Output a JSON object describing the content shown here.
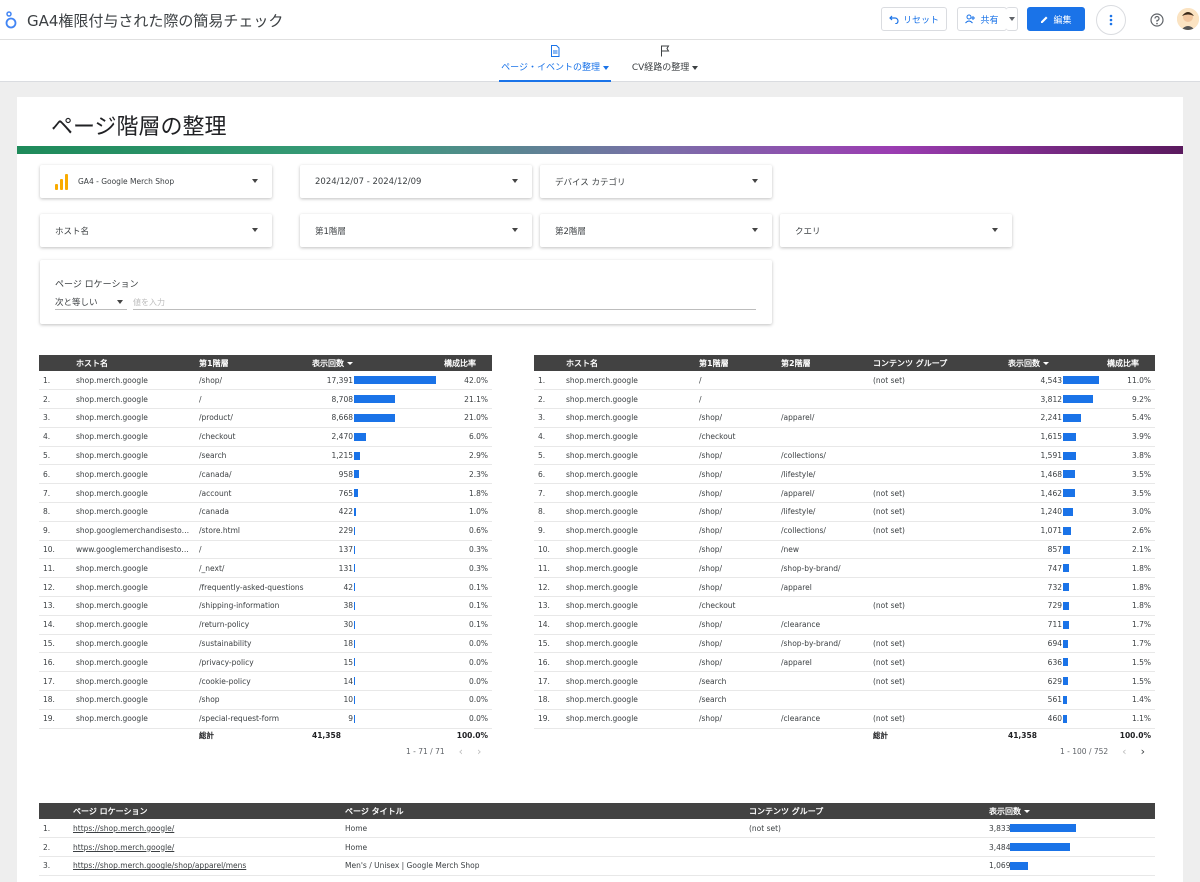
{
  "topbar": {
    "title": "GA4権限付与された際の簡易チェック",
    "reset_label": "リセット",
    "share_label": "共有",
    "edit_label": "編集"
  },
  "pagenav": {
    "pages": [
      {
        "label": "ページ・イベントの整理",
        "active": true
      },
      {
        "label": "CV経路の整理",
        "active": false
      }
    ]
  },
  "page": {
    "heading": "ページ階層の整理"
  },
  "controls": {
    "data_source": "GA4 - Google Merch Shop",
    "date_range": "2024/12/07 - 2024/12/09",
    "device_category": "デバイス カテゴリ",
    "host_name": "ホスト名",
    "level1": "第1階層",
    "level2": "第2階層",
    "query": "クエリ",
    "page_location": {
      "label": "ページ ロケーション",
      "operator": "次と等しい",
      "placeholder": "値を入力"
    }
  },
  "table1": {
    "headers": [
      "ホスト名",
      "第1階層",
      "表示回数",
      "構成比率"
    ],
    "max_value": 17391,
    "rows": [
      {
        "n": "1.",
        "host": "shop.merch.google",
        "l1": "/shop/",
        "views": "17,391",
        "value": 17391,
        "share": "42.0%"
      },
      {
        "n": "2.",
        "host": "shop.merch.google",
        "l1": "/",
        "views": "8,708",
        "value": 8708,
        "share": "21.1%"
      },
      {
        "n": "3.",
        "host": "shop.merch.google",
        "l1": "/product/",
        "views": "8,668",
        "value": 8668,
        "share": "21.0%"
      },
      {
        "n": "4.",
        "host": "shop.merch.google",
        "l1": "/checkout",
        "views": "2,470",
        "value": 2470,
        "share": "6.0%"
      },
      {
        "n": "5.",
        "host": "shop.merch.google",
        "l1": "/search",
        "views": "1,215",
        "value": 1215,
        "share": "2.9%"
      },
      {
        "n": "6.",
        "host": "shop.merch.google",
        "l1": "/canada/",
        "views": "958",
        "value": 958,
        "share": "2.3%"
      },
      {
        "n": "7.",
        "host": "shop.merch.google",
        "l1": "/account",
        "views": "765",
        "value": 765,
        "share": "1.8%"
      },
      {
        "n": "8.",
        "host": "shop.merch.google",
        "l1": "/canada",
        "views": "422",
        "value": 422,
        "share": "1.0%"
      },
      {
        "n": "9.",
        "host": "shop.googlemerchandisestore...",
        "l1": "/store.html",
        "views": "229",
        "value": 229,
        "share": "0.6%"
      },
      {
        "n": "10.",
        "host": "www.googlemerchandisestore...",
        "l1": "/",
        "views": "137",
        "value": 137,
        "share": "0.3%"
      },
      {
        "n": "11.",
        "host": "shop.merch.google",
        "l1": "/_next/",
        "views": "131",
        "value": 131,
        "share": "0.3%"
      },
      {
        "n": "12.",
        "host": "shop.merch.google",
        "l1": "/frequently-asked-questions",
        "views": "42",
        "value": 42,
        "share": "0.1%"
      },
      {
        "n": "13.",
        "host": "shop.merch.google",
        "l1": "/shipping-information",
        "views": "38",
        "value": 38,
        "share": "0.1%"
      },
      {
        "n": "14.",
        "host": "shop.merch.google",
        "l1": "/return-policy",
        "views": "30",
        "value": 30,
        "share": "0.1%"
      },
      {
        "n": "15.",
        "host": "shop.merch.google",
        "l1": "/sustainability",
        "views": "18",
        "value": 18,
        "share": "0.0%"
      },
      {
        "n": "16.",
        "host": "shop.merch.google",
        "l1": "/privacy-policy",
        "views": "15",
        "value": 15,
        "share": "0.0%"
      },
      {
        "n": "17.",
        "host": "shop.merch.google",
        "l1": "/cookie-policy",
        "views": "14",
        "value": 14,
        "share": "0.0%"
      },
      {
        "n": "18.",
        "host": "shop.merch.google",
        "l1": "/shop",
        "views": "10",
        "value": 10,
        "share": "0.0%"
      },
      {
        "n": "19.",
        "host": "shop.merch.google",
        "l1": "/special-request-form",
        "views": "9",
        "value": 9,
        "share": "0.0%"
      }
    ],
    "total_label": "総計",
    "total_views": "41,358",
    "total_share": "100.0%",
    "pagination": "1 - 71 / 71"
  },
  "table2": {
    "headers": [
      "ホスト名",
      "第1階層",
      "第2階層",
      "コンテンツ グループ",
      "表示回数",
      "構成比率"
    ],
    "max_value": 4543,
    "rows": [
      {
        "n": "1.",
        "host": "shop.merch.google",
        "l1": "/",
        "l2": "",
        "cg": "(not set)",
        "views": "4,543",
        "value": 4543,
        "share": "11.0%"
      },
      {
        "n": "2.",
        "host": "shop.merch.google",
        "l1": "/",
        "l2": "",
        "cg": "",
        "views": "3,812",
        "value": 3812,
        "share": "9.2%"
      },
      {
        "n": "3.",
        "host": "shop.merch.google",
        "l1": "/shop/",
        "l2": "/apparel/",
        "cg": "",
        "views": "2,241",
        "value": 2241,
        "share": "5.4%"
      },
      {
        "n": "4.",
        "host": "shop.merch.google",
        "l1": "/checkout",
        "l2": "",
        "cg": "",
        "views": "1,615",
        "value": 1615,
        "share": "3.9%"
      },
      {
        "n": "5.",
        "host": "shop.merch.google",
        "l1": "/shop/",
        "l2": "/collections/",
        "cg": "",
        "views": "1,591",
        "value": 1591,
        "share": "3.8%"
      },
      {
        "n": "6.",
        "host": "shop.merch.google",
        "l1": "/shop/",
        "l2": "/lifestyle/",
        "cg": "",
        "views": "1,468",
        "value": 1468,
        "share": "3.5%"
      },
      {
        "n": "7.",
        "host": "shop.merch.google",
        "l1": "/shop/",
        "l2": "/apparel/",
        "cg": "(not set)",
        "views": "1,462",
        "value": 1462,
        "share": "3.5%"
      },
      {
        "n": "8.",
        "host": "shop.merch.google",
        "l1": "/shop/",
        "l2": "/lifestyle/",
        "cg": "(not set)",
        "views": "1,240",
        "value": 1240,
        "share": "3.0%"
      },
      {
        "n": "9.",
        "host": "shop.merch.google",
        "l1": "/shop/",
        "l2": "/collections/",
        "cg": "(not set)",
        "views": "1,071",
        "value": 1071,
        "share": "2.6%"
      },
      {
        "n": "10.",
        "host": "shop.merch.google",
        "l1": "/shop/",
        "l2": "/new",
        "cg": "",
        "views": "857",
        "value": 857,
        "share": "2.1%"
      },
      {
        "n": "11.",
        "host": "shop.merch.google",
        "l1": "/shop/",
        "l2": "/shop-by-brand/",
        "cg": "",
        "views": "747",
        "value": 747,
        "share": "1.8%"
      },
      {
        "n": "12.",
        "host": "shop.merch.google",
        "l1": "/shop/",
        "l2": "/apparel",
        "cg": "",
        "views": "732",
        "value": 732,
        "share": "1.8%"
      },
      {
        "n": "13.",
        "host": "shop.merch.google",
        "l1": "/checkout",
        "l2": "",
        "cg": "(not set)",
        "views": "729",
        "value": 729,
        "share": "1.8%"
      },
      {
        "n": "14.",
        "host": "shop.merch.google",
        "l1": "/shop/",
        "l2": "/clearance",
        "cg": "",
        "views": "711",
        "value": 711,
        "share": "1.7%"
      },
      {
        "n": "15.",
        "host": "shop.merch.google",
        "l1": "/shop/",
        "l2": "/shop-by-brand/",
        "cg": "(not set)",
        "views": "694",
        "value": 694,
        "share": "1.7%"
      },
      {
        "n": "16.",
        "host": "shop.merch.google",
        "l1": "/shop/",
        "l2": "/apparel",
        "cg": "(not set)",
        "views": "636",
        "value": 636,
        "share": "1.5%"
      },
      {
        "n": "17.",
        "host": "shop.merch.google",
        "l1": "/search",
        "l2": "",
        "cg": "(not set)",
        "views": "629",
        "value": 629,
        "share": "1.5%"
      },
      {
        "n": "18.",
        "host": "shop.merch.google",
        "l1": "/search",
        "l2": "",
        "cg": "",
        "views": "561",
        "value": 561,
        "share": "1.4%"
      },
      {
        "n": "19.",
        "host": "shop.merch.google",
        "l1": "/shop/",
        "l2": "/clearance",
        "cg": "(not set)",
        "views": "460",
        "value": 460,
        "share": "1.1%"
      }
    ],
    "total_label": "総計",
    "total_views": "41,358",
    "total_share": "100.0%",
    "pagination": "1 - 100 / 752"
  },
  "table3": {
    "headers": [
      "ページ ロケーション",
      "ページ タイトル",
      "コンテンツ グループ",
      "表示回数"
    ],
    "max_value": 3833,
    "rows": [
      {
        "n": "1.",
        "loc": "https://shop.merch.google/",
        "title": "Home",
        "cg": "(not set)",
        "views": "3,833",
        "value": 3833
      },
      {
        "n": "2.",
        "loc": "https://shop.merch.google/",
        "title": "Home",
        "cg": "",
        "views": "3,484",
        "value": 3484
      },
      {
        "n": "3.",
        "loc": "https://shop.merch.google/shop/apparel/mens",
        "title": "Men's / Unisex | Google Merch Shop",
        "cg": "",
        "views": "1,069",
        "value": 1069
      }
    ]
  },
  "colors": {
    "accent": "#1a73e8",
    "header_bg": "#424242",
    "bar": "#1a73e8",
    "ga_orange": "#f9ab00"
  }
}
